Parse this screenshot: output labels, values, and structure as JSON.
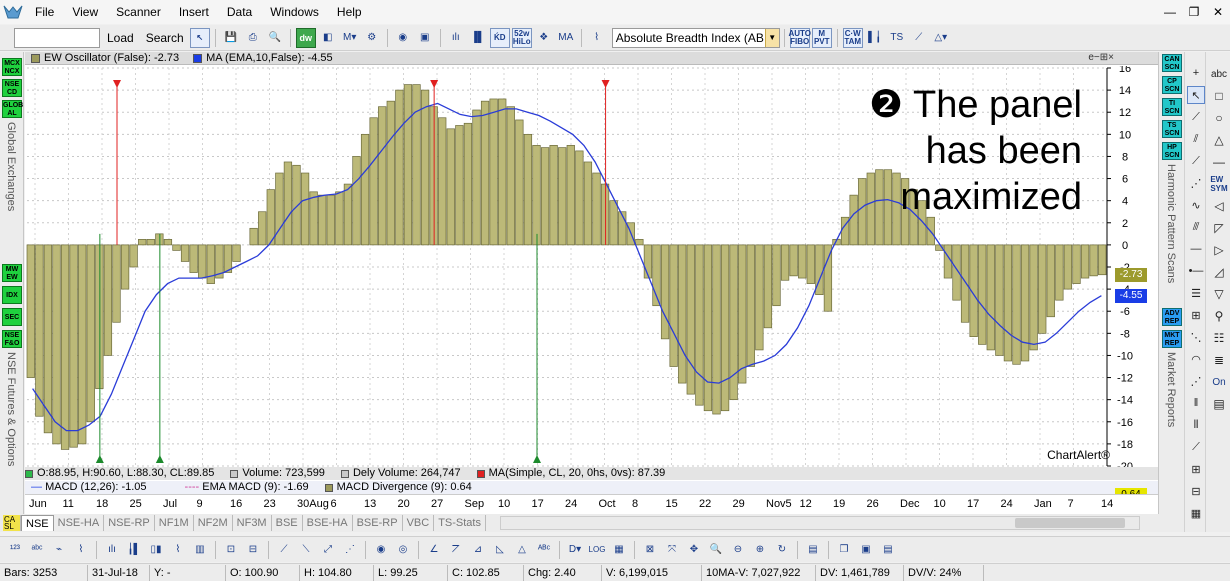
{
  "menu": {
    "items": [
      "File",
      "View",
      "Scanner",
      "Insert",
      "Data",
      "Windows",
      "Help"
    ]
  },
  "toolbar": {
    "load_label": "Load",
    "search_label": "Search",
    "indicator_value": "Absolute Breadth Index (ABI"
  },
  "left_panel": {
    "buttons": [
      [
        "MCX",
        "NCX"
      ],
      [
        "NSE",
        "CD"
      ],
      [
        "GLOB",
        "AL"
      ],
      [
        "MW",
        "EW"
      ],
      [
        "IDX"
      ],
      [
        "SEC"
      ],
      [
        "NSE",
        "F&O"
      ]
    ],
    "section1": "Global Exchanges",
    "section2": "NSE Futures & Options"
  },
  "right_panel": {
    "buttons": [
      [
        "CAN",
        "SCN"
      ],
      [
        "CP",
        "SCN"
      ],
      [
        "TI",
        "SCN"
      ],
      [
        "TS",
        "SCN"
      ],
      [
        "HP",
        "SCN"
      ],
      [
        "ADV",
        "REP"
      ],
      [
        "MKT",
        "REP"
      ]
    ],
    "section1": "Harmonic Pattern Scans",
    "section2": "Market Reports"
  },
  "chart_header": {
    "osc_label": "EW Oscillator (False): -2.73",
    "ma_label": "MA (EMA,10,False): -4.55",
    "controls": "e−⊞×"
  },
  "overlay": {
    "line1": "❷ The panel",
    "line2": "has been",
    "line3": "maximized"
  },
  "watermark": "ChartAlert®",
  "value_tags": {
    "osc": "-2.73",
    "ma": "-4.55",
    "bottom": "0.64"
  },
  "ohlc_strip": {
    "ohlc": "O:88.95, H:90.60, L:88.30, CL:89.85",
    "volume": "Volume: 723,599",
    "dely": "Dely Volume: 264,747",
    "ma": "MA(Simple, CL, 20, 0hs, 0vs): 87.39"
  },
  "macd_strip": {
    "macd": "MACD (12,26): -1.05",
    "ema": "EMA MACD (9): -1.69",
    "div": "MACD Divergence (9): 0.64"
  },
  "date_axis": [
    "Jun",
    "11",
    "18",
    "25",
    "Jul",
    "9",
    "16",
    "23",
    "30Aug",
    "6",
    "13",
    "20",
    "27",
    "Sep",
    "10",
    "17",
    "24",
    "Oct",
    "8",
    "15",
    "22",
    "29",
    "Nov5",
    "12",
    "19",
    "26",
    "Dec",
    "10",
    "17",
    "24",
    "Jan",
    "7",
    "14"
  ],
  "tabs": [
    "NSE",
    "NSE-HA",
    "NSE-RP",
    "NF1M",
    "NF2M",
    "NF3M",
    "BSE",
    "BSE-HA",
    "BSE-RP",
    "VBC",
    "TS-Stats"
  ],
  "status": {
    "bars": "Bars: 3253",
    "date": "31-Jul-18",
    "y": "Y: -",
    "open": "O: 100.90",
    "high": "H: 104.80",
    "low": "L: 99.25",
    "close": "C: 102.85",
    "chg": "Chg: 2.40",
    "vol": "V: 6,199,015",
    "mav": "10MA-V: 7,027,922",
    "dv": "DV: 1,461,789",
    "dvv": "DV/V: 24%"
  },
  "chart_data": {
    "type": "bar",
    "y_ticks": [
      16,
      14,
      12,
      10,
      8,
      6,
      4,
      2,
      0,
      -2,
      -4,
      -6,
      -8,
      -10,
      -12,
      -14,
      -16,
      -18,
      -20
    ],
    "ylim": [
      -20,
      16
    ],
    "series": [
      {
        "name": "EW Oscillator (False)",
        "values": [
          -12,
          -15.5,
          -17,
          -18,
          -18.5,
          -18.3,
          -18,
          -16,
          -13,
          -10,
          -7,
          -4,
          -2,
          0.5,
          0.5,
          1,
          0.5,
          -0.5,
          -1.5,
          -2.5,
          -3,
          -3.5,
          -3,
          -2.5,
          -1.5,
          0,
          1.5,
          3,
          5,
          6.5,
          7.5,
          7.2,
          6.5,
          4.8,
          4.5,
          4.5,
          4.8,
          5.5,
          8,
          10,
          11.5,
          12.5,
          13,
          14,
          14.5,
          14.5,
          14,
          12.5,
          11.5,
          10.5,
          10.8,
          11,
          12.2,
          13,
          13.2,
          13.2,
          12.5,
          11.3,
          10,
          9,
          8.8,
          9,
          8.8,
          9,
          8.5,
          7.5,
          6.5,
          5.5,
          4,
          3,
          2,
          0.5,
          -3,
          -5.5,
          -8.5,
          -11,
          -12.5,
          -13.5,
          -14.5,
          -15,
          -15.3,
          -15,
          -14,
          -12.5,
          -11,
          -9.5,
          -7.5,
          -5.5,
          -3.2,
          -2.8,
          -3,
          -3.5,
          -4.5,
          -6,
          0.5,
          2.5,
          4.5,
          6,
          6.5,
          6.8,
          6.8,
          6.5,
          6,
          5,
          4,
          2.5,
          -0.5,
          -3,
          -5,
          -7,
          -8.3,
          -9,
          -9.5,
          -10,
          -10.5,
          -10.8,
          -10.5,
          -9.5,
          -8,
          -6.5,
          -5,
          -4,
          -3.5,
          -3,
          -2.8,
          -2.7
        ]
      },
      {
        "name": "MA (EMA,10,False)",
        "type": "line",
        "values": [
          -13,
          -14.5,
          -16,
          -16.8,
          -16.8,
          -16.3,
          -15.5,
          -13.5,
          -11,
          -8.5,
          -6,
          -4.5,
          -3.5,
          -3,
          -3,
          -3,
          -2.8,
          -2.5,
          -2,
          -1.5,
          -1,
          0,
          1.5,
          3,
          4,
          4.3,
          4.5,
          4.6,
          5,
          6,
          7.2,
          8.5,
          9.8,
          11,
          12,
          12.5,
          12.8,
          12.3,
          11.8,
          11.6,
          11.7,
          12,
          12.3,
          12.3,
          12,
          11.7,
          11.2,
          10.6,
          10,
          9,
          7.5,
          5.5,
          3.5,
          1.5,
          -1,
          -3.5,
          -6,
          -8,
          -10,
          -11.5,
          -12.4,
          -12.5,
          -12,
          -11.2,
          -10.8,
          -10.5,
          -10,
          -9,
          -7.5,
          -5.5,
          -3,
          -0.5,
          1.5,
          2.8,
          3.6,
          4,
          4.1,
          3.8,
          3.2,
          2.2,
          1,
          -0.5,
          -2,
          -3.5,
          -5,
          -6.3,
          -7.3,
          -8.2,
          -8.8,
          -9,
          -8.8,
          -8,
          -7,
          -6,
          -5.2,
          -4.6
        ]
      }
    ],
    "markers": {
      "green_up": [
        8,
        15,
        59
      ],
      "red_down": [
        10,
        47,
        67
      ]
    }
  }
}
